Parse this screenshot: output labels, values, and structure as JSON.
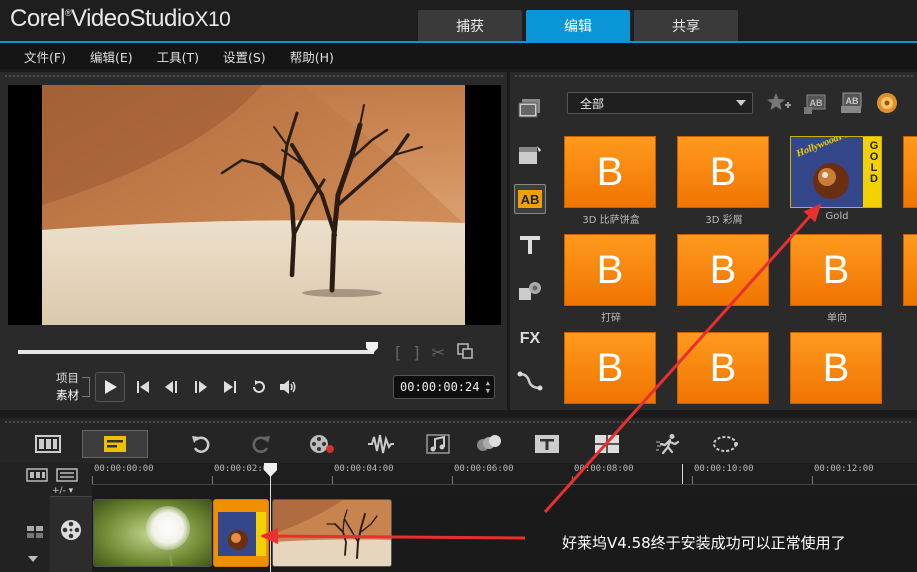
{
  "app": {
    "logo_brand": "Corel",
    "logo_product": "VideoStudio",
    "logo_version": "X10",
    "logo_sup": "®"
  },
  "tabs": [
    {
      "label": "捕获",
      "active": false
    },
    {
      "label": "编辑",
      "active": true
    },
    {
      "label": "共享",
      "active": false
    }
  ],
  "menu": [
    "文件(F)",
    "编辑(E)",
    "工具(T)",
    "设置(S)",
    "帮助(H)"
  ],
  "player": {
    "mode_project": "项目",
    "mode_clip": "素材",
    "timecode": "00:00:00:24",
    "scrub_position": 0.99
  },
  "library": {
    "category": "全部",
    "thumbnails": [
      {
        "label": "3D 比萨饼盒",
        "kind": "B"
      },
      {
        "label": "3D 彩屑",
        "kind": "B"
      },
      {
        "label": "Gold",
        "kind": "gold"
      },
      {
        "label": "打碎",
        "kind": "B"
      },
      {
        "label": "",
        "kind": "B"
      },
      {
        "label": "单向",
        "kind": "B"
      },
      {
        "label": "",
        "kind": "B"
      },
      {
        "label": "",
        "kind": "B"
      },
      {
        "label": "",
        "kind": "B"
      }
    ],
    "thumb_letter": "B",
    "gold_badge": "GOLD",
    "gold_text": "HollywoodFX"
  },
  "timeline": {
    "ruler": [
      "00:00:00:00",
      "00:00:02:00",
      "00:00:04:00",
      "00:00:06:00",
      "00:00:08:00",
      "00:00:10:00",
      "00:00:12:00"
    ],
    "zoom_control": "+/- ▾"
  },
  "annotation": {
    "text": "好莱坞V4.58终于安装成功可以正常使用了"
  },
  "colors": {
    "accent": "#0a95d6",
    "thumb_orange": "#f58a0f",
    "arrow_red": "#e83030"
  }
}
